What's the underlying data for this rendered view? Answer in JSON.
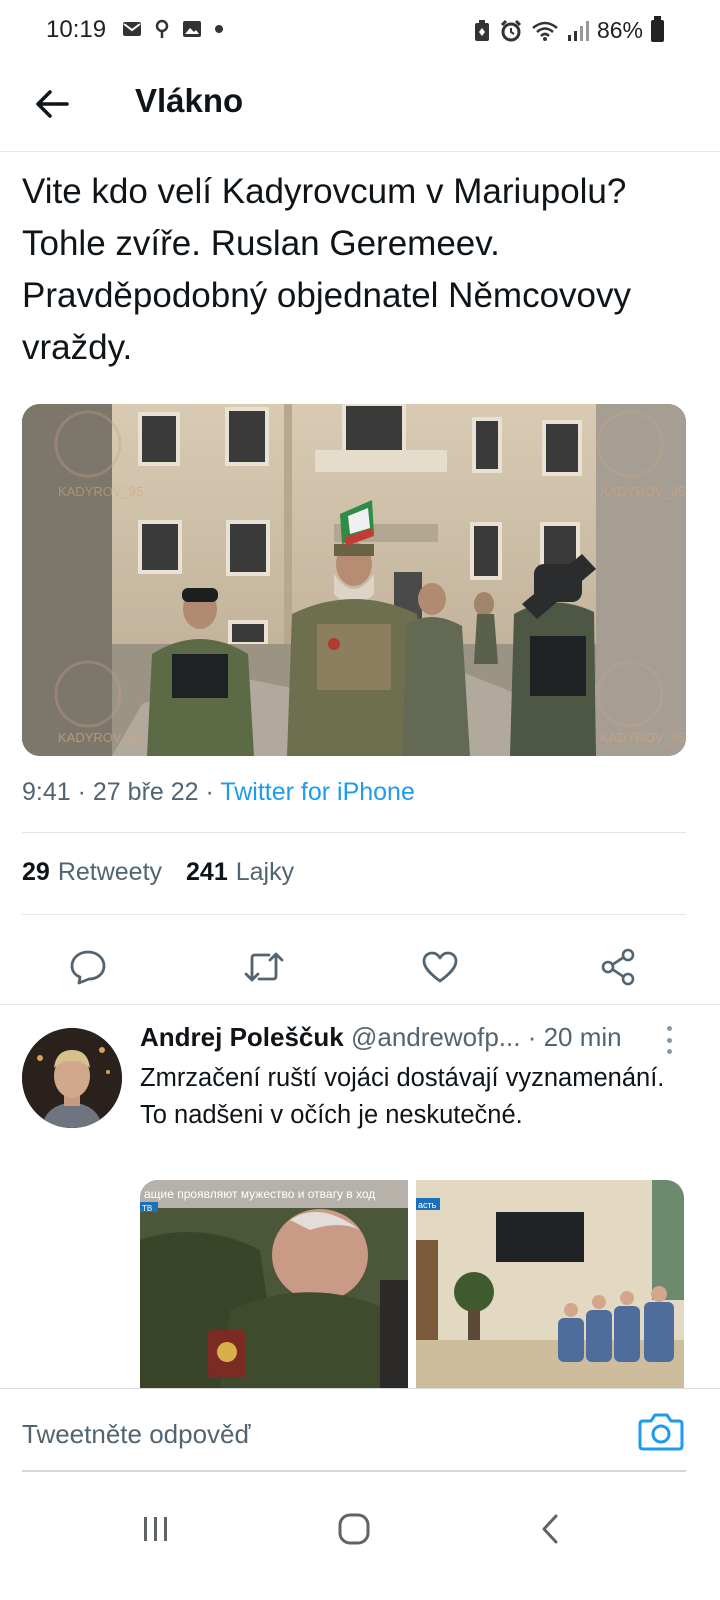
{
  "status_bar": {
    "time": "10:19",
    "battery": "86%",
    "left_icons": [
      "mail-icon",
      "location-icon",
      "image-icon",
      "dot-icon"
    ],
    "right_icons": [
      "battery-saver-icon",
      "alarm-icon",
      "wifi-icon",
      "signal-icon",
      "battery-icon"
    ]
  },
  "header": {
    "title": "Vlákno",
    "back_icon": "arrow-left-icon"
  },
  "tweet": {
    "text": "Vite kdo velí Kadyrovcum v Mariupolu? Tohle zvíře. Ruslan Geremeev. Pravděpodobný objednatel Němcovovy vraždy.",
    "time": "9:41",
    "date": "27 bře 22",
    "separator": "·",
    "source": "Twitter for iPhone",
    "watermark": "KADYROV_95",
    "stats": {
      "retweets_count": "29",
      "retweets_label": "Retweety",
      "likes_count": "241",
      "likes_label": "Lajky"
    },
    "actions": [
      "reply-icon",
      "retweet-icon",
      "like-icon",
      "share-icon"
    ]
  },
  "reply": {
    "name": "Andrej Poleščuk",
    "handle": "@andrewofp...",
    "time": "· 20 min",
    "text": "Zmrzačení ruští vojáci dostávají vyznamenání. To nadšeni v očích je neskutečné.",
    "media_caption_1": "ащие проявляют мужество и отвагу в ход",
    "media_tag_1": "ТВ",
    "media_tag_2": "асть"
  },
  "composer": {
    "placeholder": "Tweetněte odpověď"
  },
  "nav_bar": {
    "buttons": [
      "recents-icon",
      "home-icon",
      "back-icon"
    ]
  },
  "colors": {
    "accent": "#1d9bf0",
    "text": "#0f1419",
    "secondary": "#536471",
    "divider": "#e6e6e6"
  }
}
